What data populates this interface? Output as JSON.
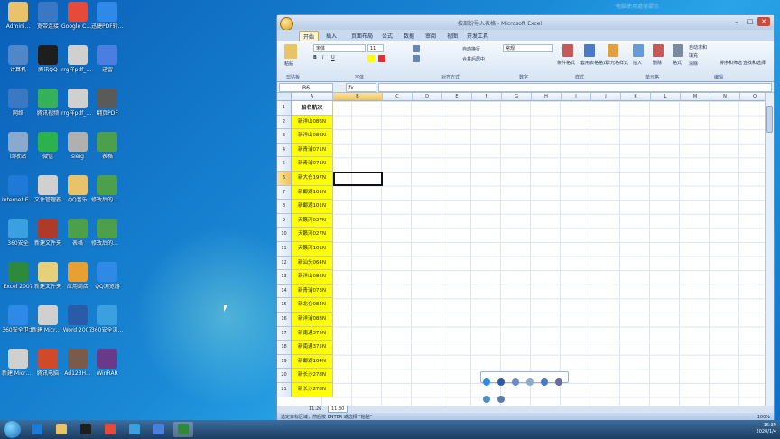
{
  "desktop": {
    "icons": [
      {
        "label": "Admini...",
        "color": "#e8c36a"
      },
      {
        "label": "宽带连接",
        "color": "#3a78c4"
      },
      {
        "label": "Google Chrome",
        "color": "#e64a3a"
      },
      {
        "label": "迅捷PDF转换器",
        "color": "#2e8ae6"
      },
      {
        "label": "计算机",
        "color": "#4f87c9"
      },
      {
        "label": "腾讯QQ",
        "color": "#1e1e1e"
      },
      {
        "label": "rrg样pdf_1a8707",
        "color": "#d0d0d0"
      },
      {
        "label": "迅雷",
        "color": "#4a7ee0"
      },
      {
        "label": "网络",
        "color": "#3a78c4"
      },
      {
        "label": "腾讯视频",
        "color": "#36b05a"
      },
      {
        "label": "rrg样pdf_1a8707",
        "color": "#d0d0d0"
      },
      {
        "label": "翻页PDF",
        "color": "#5a5a5a"
      },
      {
        "label": "回收站",
        "color": "#8aa9cc"
      },
      {
        "label": "微信",
        "color": "#2bb24c"
      },
      {
        "label": "sleig",
        "color": "#b0b0b0"
      },
      {
        "label": "表格",
        "color": "#4ca04c"
      },
      {
        "label": "Internet Explorer",
        "color": "#1e7ad6"
      },
      {
        "label": "文件管理器",
        "color": "#d0d0d0"
      },
      {
        "label": "QQ音乐",
        "color": "#e8c36a"
      },
      {
        "label": "修改后的合并表格",
        "color": "#4ca04c"
      },
      {
        "label": "360安全",
        "color": "#3aa0e0"
      },
      {
        "label": "新建文件夹",
        "color": "#b03a2a"
      },
      {
        "label": "表格",
        "color": "#4ca04c"
      },
      {
        "label": "修改后的合并表格",
        "color": "#4ca04c"
      },
      {
        "label": "Excel 2007",
        "color": "#2e8a3a"
      },
      {
        "label": "新建文件夹",
        "color": "#e8d07a"
      },
      {
        "label": "应用商店",
        "color": "#e8a030"
      },
      {
        "label": "QQ浏览器",
        "color": "#2e8ae6"
      },
      {
        "label": "360安全卫士",
        "color": "#2e8ae6"
      },
      {
        "label": "新建 Microsoft...",
        "color": "#d0d0d0"
      },
      {
        "label": "Word 2007",
        "color": "#2a5aa8"
      },
      {
        "label": "360安全浏览器",
        "color": "#3aa0e0"
      },
      {
        "label": "新建 Microsoft...",
        "color": "#d0d0d0"
      },
      {
        "label": "腾讯电脑",
        "color": "#d04a2a"
      },
      {
        "label": "Ad123H...",
        "color": "#7a5a4a"
      },
      {
        "label": "WinRAR",
        "color": "#6a3a8a"
      }
    ]
  },
  "notification": "电脑使用道德提示",
  "excel": {
    "window_title": "按部份导入表格 - Microsoft Excel",
    "tabs": [
      "开始",
      "插入",
      "页面布局",
      "公式",
      "数据",
      "审阅",
      "视图",
      "开发工具"
    ],
    "active_tab": "开始",
    "ribbon": {
      "paste": "粘贴",
      "font_name": "宋体",
      "font_size": "11",
      "wrap": "自动换行",
      "merge": "合并后居中",
      "number_format": "常规",
      "cond_format": "条件格式",
      "table_format": "套用表格格式",
      "cell_style": "单元格样式",
      "insert": "插入",
      "delete": "删除",
      "format": "格式",
      "autosum": "自动求和",
      "fill": "填充",
      "clear": "清除",
      "sort": "排序和筛选",
      "find": "查找和选择",
      "groups": [
        "剪贴板",
        "字体",
        "对齐方式",
        "数字",
        "样式",
        "单元格",
        "编辑"
      ]
    },
    "name_box": "B6",
    "fx": "fx",
    "columns": [
      "A",
      "B",
      "C",
      "D",
      "E",
      "F",
      "G",
      "H",
      "I",
      "J",
      "K",
      "L",
      "M",
      "N",
      "O"
    ],
    "header_cell": "船名航次",
    "rows": [
      "1",
      "2",
      "3",
      "4",
      "5",
      "6",
      "7",
      "8",
      "9",
      "10",
      "11",
      "12",
      "13",
      "14",
      "15",
      "16",
      "17",
      "18",
      "19",
      "20",
      "21"
    ],
    "column_a": [
      "新洋山086N",
      "新洋山086N",
      "新青浦071N",
      "新青浦071N",
      "新大仓197N",
      "新鄱湖101N",
      "新鄱湖101N",
      "天籁河027N",
      "天籁河027N",
      "天籁河101N",
      "新汕头064N",
      "新洋山086N",
      "新青浦073N",
      "新北仑084N",
      "新洋浦088N",
      "新南通375N",
      "新南通375N",
      "新鄱湖104N",
      "新长沙278N",
      "新长沙278N"
    ],
    "sheet_tabs": [
      "11.26",
      "11.30"
    ],
    "status": "选定目标区域，然后按 ENTER 或选择 \"粘贴\"",
    "zoom": "100%"
  },
  "taskbar": {
    "time": "16:39",
    "date": "2020/1/4",
    "apps": [
      "ie",
      "folder",
      "qq",
      "chrome",
      "edge",
      "feather",
      "excel"
    ]
  }
}
